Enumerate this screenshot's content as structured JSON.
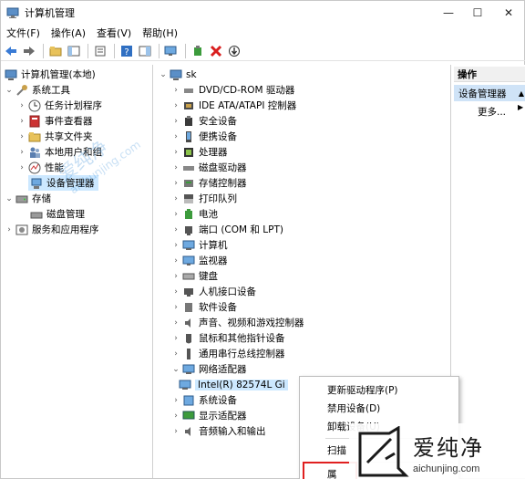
{
  "window": {
    "title": "计算机管理",
    "minimize": "—",
    "maximize": "☐",
    "close": "✕"
  },
  "menu": [
    "文件(F)",
    "操作(A)",
    "查看(V)",
    "帮助(H)"
  ],
  "toolbar_icons": [
    "back-icon",
    "forward-icon",
    "up-folder-icon",
    "console-tree-icon",
    "properties-icon",
    "help-icon",
    "show-hide-icon",
    "scan-hardware-icon",
    "add-driver-icon",
    "disable-icon",
    "uninstall-icon",
    "update-icon"
  ],
  "left_tree": {
    "root": "计算机管理(本地)",
    "system_tools": "系统工具",
    "task_scheduler": "任务计划程序",
    "event_viewer": "事件查看器",
    "shared_folders": "共享文件夹",
    "local_users": "本地用户和组",
    "performance": "性能",
    "device_manager": "设备管理器",
    "storage": "存储",
    "disk_management": "磁盘管理",
    "services_apps": "服务和应用程序"
  },
  "device_tree": {
    "root": "sk",
    "items": [
      "DVD/CD-ROM 驱动器",
      "IDE ATA/ATAPI 控制器",
      "安全设备",
      "便携设备",
      "处理器",
      "磁盘驱动器",
      "存储控制器",
      "打印队列",
      "电池",
      "端口 (COM 和 LPT)",
      "计算机",
      "监视器",
      "键盘",
      "人机接口设备",
      "软件设备",
      "声音、视频和游戏控制器",
      "鼠标和其他指针设备",
      "通用串行总线控制器",
      "网络适配器"
    ],
    "network_child": "Intel(R) 82574L Gi",
    "after": [
      "系统设备",
      "显示适配器",
      "音频输入和输出"
    ]
  },
  "actions": {
    "header": "操作",
    "device_manager": "设备管理器",
    "more": "更多..."
  },
  "context_menu": {
    "update_driver": "更新驱动程序(P)",
    "disable": "禁用设备(D)",
    "uninstall": "卸载设备(U)",
    "scan": "扫描",
    "properties": "属"
  },
  "watermark": {
    "cn": "爱纯净",
    "en": "aichunjing.com",
    "ghost_cn": "爱纯净",
    "ghost_en": "aichunjing.com"
  },
  "colors": {
    "selection": "#cce8ff",
    "highlight": "#cfe3f7",
    "red_box": "#e02020",
    "watermark_blue": "#3a8fd9"
  }
}
